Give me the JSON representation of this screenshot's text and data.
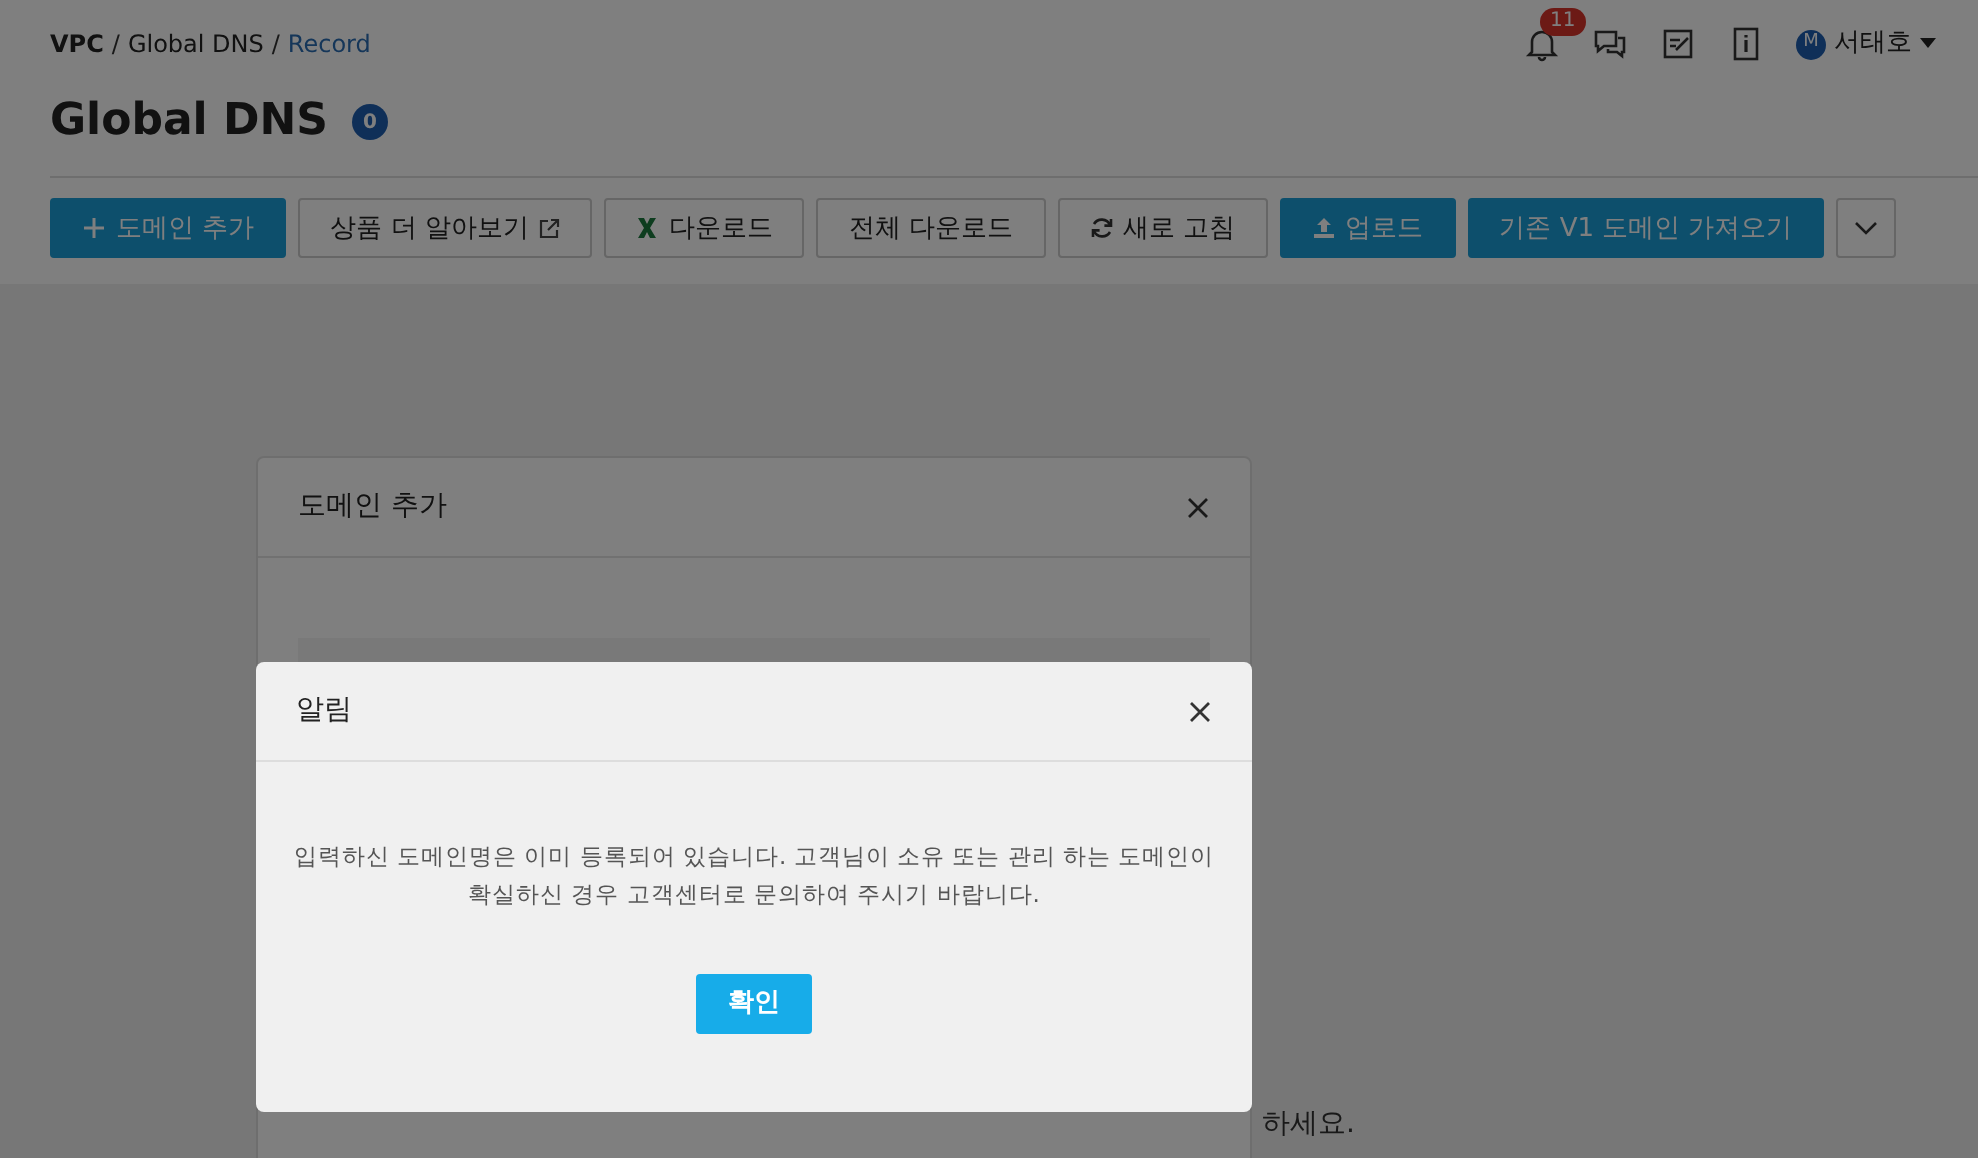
{
  "breadcrumb": [
    {
      "label": "VPC",
      "kind": "root",
      "separator": "/"
    },
    {
      "label": "Global DNS",
      "kind": "link",
      "separator": "/"
    },
    {
      "label": "Record",
      "kind": "current"
    }
  ],
  "header": {
    "notification_count": "11",
    "user_initial": "M",
    "user_name": "서태호"
  },
  "title": "Global DNS",
  "title_badge": "0",
  "toolbar": [
    {
      "label": "도메인 추가",
      "kind": "primary"
    },
    {
      "label": "상품 더 알아보기",
      "kind": "outline"
    },
    {
      "label": "다운로드",
      "kind": "outline"
    },
    {
      "label": "전체 다운로드",
      "kind": "outline"
    },
    {
      "label": "새로 고침",
      "kind": "outline"
    },
    {
      "label": "업로드",
      "kind": "primary"
    },
    {
      "label": "기존 V1 도메인 가져오기",
      "kind": "primary"
    },
    {
      "kind": "dropdown"
    }
  ],
  "background_dialog": {
    "title": "도메인 추가",
    "hint": "하세요."
  },
  "alert": {
    "title": "알림",
    "message": "입력하신 도메인명은 이미 등록되어 있습니다. 고객님이 소유 또는 관리 하는 도메인이 확실하신 경우 고객센터로 문의하여 주시기 바랍니다.",
    "confirm": "확인"
  }
}
